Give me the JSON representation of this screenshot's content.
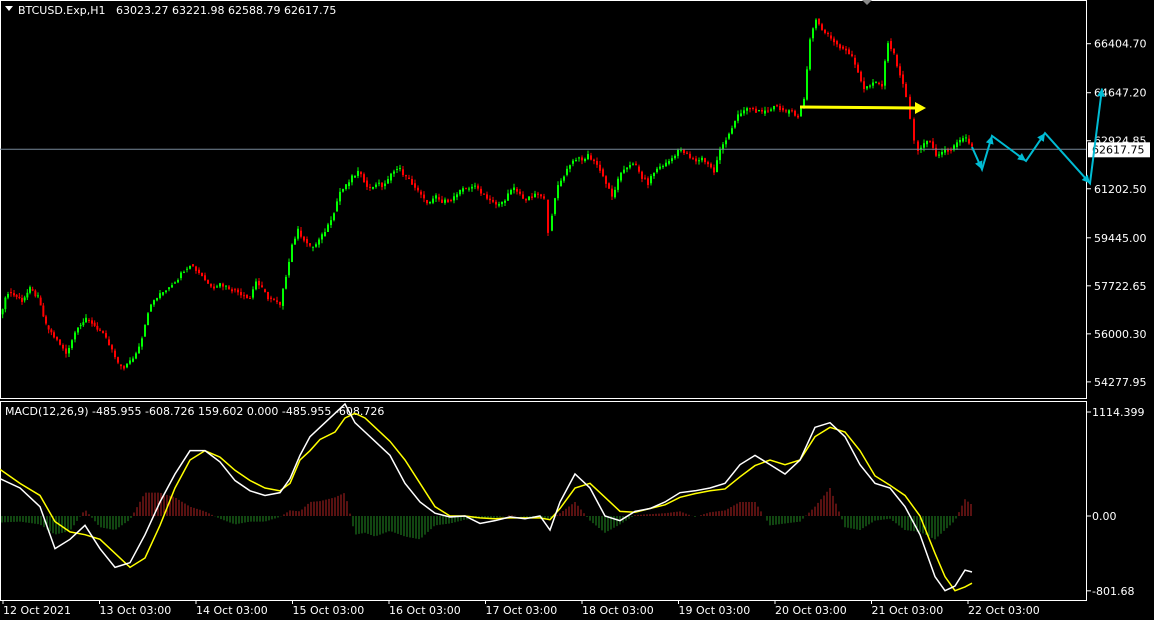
{
  "main_header": {
    "symbol": "BTCUSD.Exp,H1",
    "ohlc": "63023.27 63221.98 62588.79 62617.75"
  },
  "macd_header": {
    "text": "MACD(12,26,9) -485.955 -608.726 159.602 0.000 -485.955 -608.726"
  },
  "colors": {
    "background": "#000000",
    "bull": "#00ff00",
    "bear": "#ff0000",
    "grid": "#ffffff",
    "price_line": "#778899",
    "macd_line": "#ffffff",
    "signal_line": "#ffff00",
    "hist_pos": "#b22222",
    "hist_neg": "#228b22",
    "projection": "#00bcd4",
    "arrow_yellow": "#ffff00"
  },
  "chart_data": [
    {
      "type": "candlestick",
      "title": "BTCUSD.Exp,H1",
      "yticks": [
        "66404.70",
        "64647.20",
        "62924.85",
        "61202.50",
        "59445.00",
        "57722.65",
        "56000.30",
        "54277.95"
      ],
      "ylim": [
        53700,
        67900
      ],
      "current_price": "62617.75",
      "x_labels": [
        "12 Oct 2021",
        "13 Oct 03:00",
        "14 Oct 03:00",
        "15 Oct 03:00",
        "16 Oct 03:00",
        "17 Oct 03:00",
        "18 Oct 03:00",
        "19 Oct 03:00",
        "20 Oct 03:00",
        "21 Oct 03:00",
        "22 Oct 03:00"
      ],
      "close_path": [
        [
          0,
          56700
        ],
        [
          8,
          57500
        ],
        [
          14,
          57400
        ],
        [
          22,
          57200
        ],
        [
          30,
          57600
        ],
        [
          38,
          57300
        ],
        [
          46,
          56300
        ],
        [
          54,
          55900
        ],
        [
          60,
          55600
        ],
        [
          66,
          55300
        ],
        [
          72,
          55800
        ],
        [
          78,
          56300
        ],
        [
          86,
          56500
        ],
        [
          92,
          56400
        ],
        [
          100,
          56100
        ],
        [
          106,
          55800
        ],
        [
          112,
          55400
        ],
        [
          118,
          54900
        ],
        [
          124,
          54800
        ],
        [
          130,
          55000
        ],
        [
          136,
          55300
        ],
        [
          142,
          55900
        ],
        [
          148,
          56800
        ],
        [
          154,
          57200
        ],
        [
          160,
          57400
        ],
        [
          166,
          57600
        ],
        [
          172,
          57800
        ],
        [
          178,
          58000
        ],
        [
          184,
          58300
        ],
        [
          190,
          58500
        ],
        [
          196,
          58300
        ],
        [
          202,
          58100
        ],
        [
          208,
          57800
        ],
        [
          214,
          57700
        ],
        [
          220,
          57800
        ],
        [
          226,
          57700
        ],
        [
          232,
          57600
        ],
        [
          238,
          57500
        ],
        [
          244,
          57400
        ],
        [
          250,
          57300
        ],
        [
          256,
          57900
        ],
        [
          262,
          57600
        ],
        [
          268,
          57300
        ],
        [
          274,
          57200
        ],
        [
          280,
          57000
        ],
        [
          286,
          58100
        ],
        [
          292,
          59200
        ],
        [
          298,
          59700
        ],
        [
          304,
          59400
        ],
        [
          310,
          59100
        ],
        [
          316,
          59200
        ],
        [
          322,
          59500
        ],
        [
          328,
          59900
        ],
        [
          334,
          60400
        ],
        [
          340,
          61100
        ],
        [
          346,
          61300
        ],
        [
          352,
          61600
        ],
        [
          358,
          61800
        ],
        [
          364,
          61500
        ],
        [
          370,
          61200
        ],
        [
          376,
          61400
        ],
        [
          382,
          61300
        ],
        [
          388,
          61500
        ],
        [
          394,
          61900
        ],
        [
          400,
          61900
        ],
        [
          406,
          61600
        ],
        [
          412,
          61400
        ],
        [
          418,
          61100
        ],
        [
          424,
          60800
        ],
        [
          430,
          60700
        ],
        [
          436,
          60900
        ],
        [
          442,
          60700
        ],
        [
          448,
          60800
        ],
        [
          454,
          60900
        ],
        [
          460,
          61100
        ],
        [
          466,
          61200
        ],
        [
          472,
          61300
        ],
        [
          478,
          61200
        ],
        [
          484,
          61000
        ],
        [
          490,
          60800
        ],
        [
          496,
          60600
        ],
        [
          502,
          60700
        ],
        [
          508,
          61000
        ],
        [
          514,
          61200
        ],
        [
          520,
          61000
        ],
        [
          526,
          60800
        ],
        [
          532,
          60900
        ],
        [
          538,
          61000
        ],
        [
          544,
          60800
        ],
        [
          548,
          59700
        ],
        [
          552,
          60300
        ],
        [
          558,
          61300
        ],
        [
          564,
          61700
        ],
        [
          570,
          62100
        ],
        [
          576,
          62300
        ],
        [
          582,
          62200
        ],
        [
          588,
          62400
        ],
        [
          594,
          62200
        ],
        [
          600,
          61900
        ],
        [
          606,
          61400
        ],
        [
          612,
          60900
        ],
        [
          618,
          61500
        ],
        [
          624,
          61900
        ],
        [
          630,
          62100
        ],
        [
          636,
          62000
        ],
        [
          642,
          61600
        ],
        [
          648,
          61400
        ],
        [
          654,
          61800
        ],
        [
          660,
          62000
        ],
        [
          666,
          62100
        ],
        [
          672,
          62300
        ],
        [
          678,
          62600
        ],
        [
          684,
          62500
        ],
        [
          690,
          62300
        ],
        [
          696,
          62200
        ],
        [
          702,
          62300
        ],
        [
          708,
          62100
        ],
        [
          714,
          61800
        ],
        [
          720,
          62600
        ],
        [
          726,
          63000
        ],
        [
          732,
          63400
        ],
        [
          738,
          63800
        ],
        [
          744,
          64000
        ],
        [
          750,
          64100
        ],
        [
          756,
          64000
        ],
        [
          762,
          63900
        ],
        [
          768,
          64000
        ],
        [
          774,
          64200
        ],
        [
          780,
          64100
        ],
        [
          786,
          63900
        ],
        [
          792,
          64000
        ],
        [
          798,
          63800
        ],
        [
          804,
          64400
        ],
        [
          810,
          66600
        ],
        [
          816,
          67300
        ],
        [
          822,
          66900
        ],
        [
          828,
          66700
        ],
        [
          834,
          66500
        ],
        [
          840,
          66300
        ],
        [
          846,
          66200
        ],
        [
          852,
          65900
        ],
        [
          858,
          65400
        ],
        [
          864,
          64800
        ],
        [
          870,
          64900
        ],
        [
          876,
          65000
        ],
        [
          882,
          64900
        ],
        [
          888,
          66500
        ],
        [
          894,
          66000
        ],
        [
          900,
          65300
        ],
        [
          906,
          64500
        ],
        [
          910,
          63700
        ],
        [
          914,
          62900
        ],
        [
          918,
          62600
        ],
        [
          924,
          62800
        ],
        [
          930,
          62900
        ],
        [
          936,
          62400
        ],
        [
          942,
          62500
        ],
        [
          948,
          62600
        ],
        [
          954,
          62700
        ],
        [
          960,
          62900
        ],
        [
          966,
          63000
        ],
        [
          972,
          62700
        ]
      ]
    },
    {
      "type": "line",
      "title": "MACD(12,26,9)",
      "yticks": [
        "1114.399",
        "0.00",
        "-801.68"
      ],
      "ylim": [
        -900,
        1200
      ],
      "series": [
        {
          "name": "MACD",
          "x": [
            0,
            20,
            40,
            55,
            70,
            85,
            100,
            115,
            130,
            145,
            160,
            175,
            190,
            205,
            220,
            235,
            250,
            265,
            280,
            290,
            300,
            310,
            320,
            335,
            345,
            355,
            365,
            375,
            390,
            405,
            420,
            435,
            450,
            465,
            480,
            495,
            510,
            525,
            540,
            550,
            560,
            575,
            590,
            605,
            620,
            635,
            650,
            665,
            680,
            695,
            710,
            725,
            740,
            755,
            770,
            785,
            800,
            815,
            830,
            845,
            860,
            875,
            890,
            905,
            920,
            935,
            945,
            955,
            965,
            972
          ],
          "values": [
            400,
            300,
            100,
            -350,
            -250,
            -100,
            -350,
            -550,
            -500,
            -200,
            150,
            450,
            700,
            700,
            580,
            380,
            270,
            220,
            250,
            400,
            650,
            850,
            950,
            1100,
            1200,
            1000,
            900,
            800,
            650,
            350,
            150,
            30,
            -10,
            0,
            -80,
            -50,
            -10,
            -30,
            0,
            -150,
            150,
            450,
            300,
            0,
            -50,
            50,
            80,
            150,
            250,
            270,
            300,
            350,
            550,
            650,
            550,
            450,
            600,
            950,
            1000,
            850,
            550,
            350,
            300,
            100,
            -200,
            -650,
            -800,
            -750,
            -580,
            -600
          ]
        },
        {
          "name": "Signal",
          "x": [
            0,
            20,
            40,
            55,
            70,
            85,
            100,
            115,
            130,
            145,
            160,
            175,
            190,
            205,
            220,
            235,
            250,
            265,
            280,
            290,
            300,
            310,
            320,
            335,
            345,
            355,
            365,
            375,
            390,
            405,
            420,
            435,
            450,
            465,
            480,
            495,
            510,
            525,
            540,
            550,
            560,
            575,
            590,
            605,
            620,
            635,
            650,
            665,
            680,
            695,
            710,
            725,
            740,
            755,
            770,
            785,
            800,
            815,
            830,
            845,
            860,
            875,
            890,
            905,
            920,
            935,
            945,
            955,
            965,
            972
          ],
          "values": [
            500,
            350,
            220,
            -60,
            -170,
            -200,
            -250,
            -400,
            -550,
            -450,
            -100,
            300,
            600,
            700,
            630,
            490,
            380,
            300,
            270,
            350,
            600,
            700,
            820,
            900,
            1050,
            1100,
            1050,
            950,
            800,
            600,
            350,
            100,
            0,
            0,
            -20,
            -30,
            -20,
            -20,
            -20,
            -40,
            80,
            300,
            350,
            200,
            50,
            40,
            80,
            120,
            200,
            240,
            270,
            290,
            420,
            540,
            600,
            550,
            600,
            850,
            950,
            900,
            700,
            430,
            330,
            220,
            0,
            -400,
            -650,
            -800,
            -760,
            -720
          ]
        },
        {
          "name": "Histogram",
          "x": [
            0,
            20,
            40,
            55,
            70,
            85,
            100,
            115,
            130,
            145,
            160,
            175,
            190,
            205,
            220,
            235,
            250,
            265,
            280,
            290,
            300,
            310,
            320,
            335,
            345,
            355,
            365,
            375,
            390,
            405,
            420,
            435,
            450,
            465,
            480,
            495,
            510,
            525,
            540,
            550,
            560,
            575,
            590,
            605,
            620,
            635,
            650,
            665,
            680,
            695,
            710,
            725,
            740,
            755,
            770,
            785,
            800,
            815,
            830,
            845,
            860,
            875,
            890,
            905,
            920,
            935,
            945,
            955,
            965,
            972
          ],
          "values": [
            -70,
            -60,
            -90,
            -200,
            -160,
            70,
            -120,
            -150,
            -40,
            250,
            250,
            200,
            100,
            50,
            -30,
            -90,
            -60,
            -60,
            -10,
            60,
            50,
            150,
            160,
            200,
            250,
            -200,
            -180,
            -220,
            -160,
            -220,
            -250,
            -100,
            -80,
            -40,
            -20,
            -20,
            10,
            -10,
            -10,
            -40,
            30,
            150,
            -50,
            -180,
            -90,
            10,
            20,
            30,
            50,
            -10,
            40,
            60,
            150,
            150,
            -100,
            -80,
            -60,
            100,
            300,
            -120,
            -150,
            -50,
            -30,
            -150,
            -170,
            -250,
            -150,
            -50,
            180,
            120
          ]
        }
      ]
    }
  ]
}
